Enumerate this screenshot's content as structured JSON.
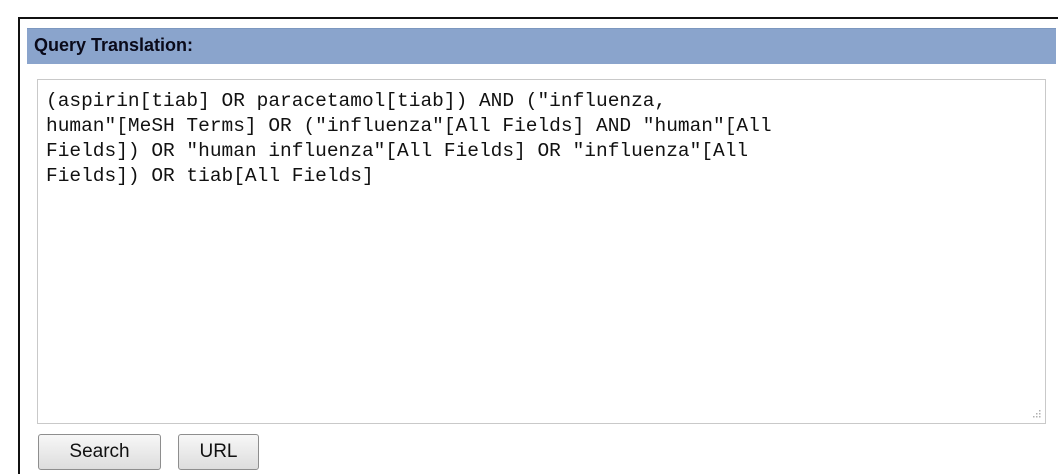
{
  "panel": {
    "title": "Query Translation:"
  },
  "query": {
    "text": "(aspirin[tiab] OR paracetamol[tiab]) AND (\"influenza,\nhuman\"[MeSH Terms] OR (\"influenza\"[All Fields] AND \"human\"[All\nFields]) OR \"human influenza\"[All Fields] OR \"influenza\"[All\nFields]) OR tiab[All Fields]"
  },
  "buttons": {
    "search_label": "Search",
    "url_label": "URL"
  },
  "colors": {
    "header_bg": "#8aa4cc",
    "box_border": "#c9c9c9"
  },
  "icons": {
    "resize": "resize-grip-icon"
  }
}
